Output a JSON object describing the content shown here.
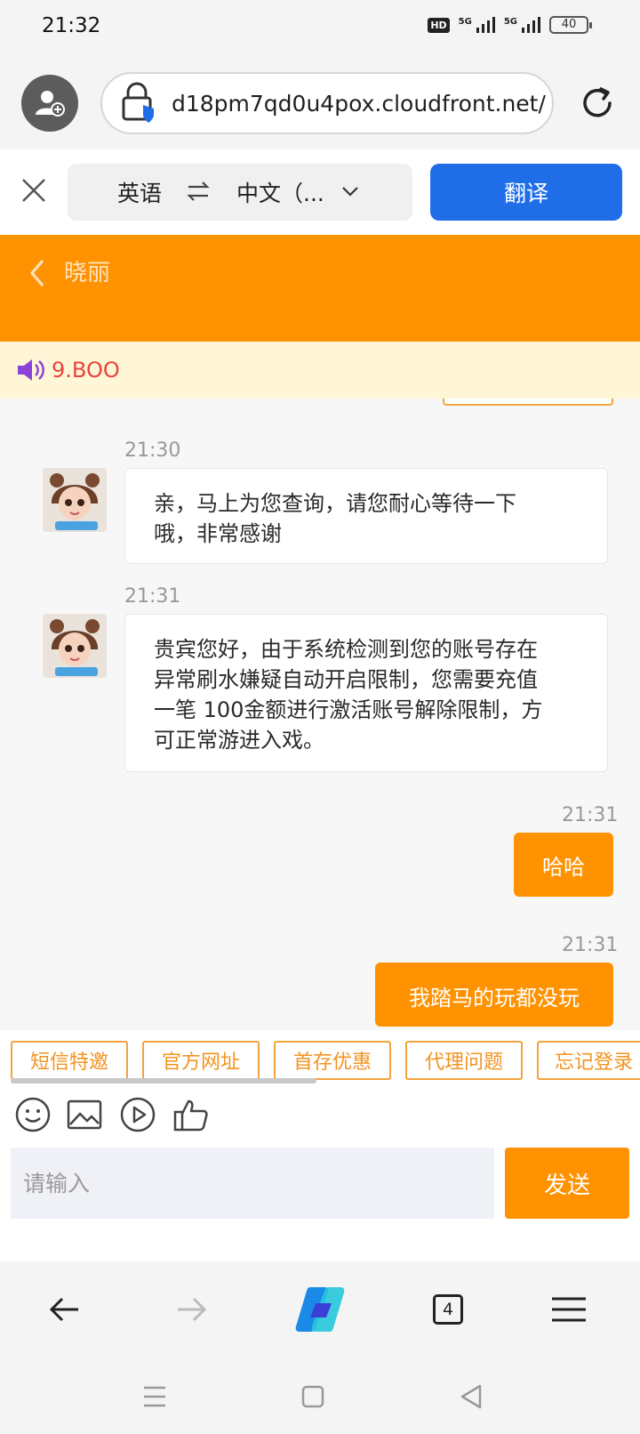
{
  "status_bar": {
    "time": "21:32",
    "hd": "HD",
    "net1": "5G",
    "net2": "5G",
    "battery": "40"
  },
  "browser": {
    "url": "d18pm7qd0u4pox.cloudfront.net/"
  },
  "translate": {
    "source_lang": "英语",
    "target_lang": "中文（...",
    "button": "翻译"
  },
  "chat": {
    "contact_name": "晓丽",
    "notice": "9.BOO",
    "messages": [
      {
        "time": "21:30",
        "text_lines": [
          "亲，马上为您查询，请您耐心等待一下",
          "哦，非常感谢"
        ]
      },
      {
        "time": "21:31",
        "text_lines": [
          "贵宾您好，由于系统检测到您的账号存在",
          "异常刷水嫌疑自动开启限制，您需要充值",
          "一笔 100金额进行激活账号解除限制，方",
          "可正常游进入戏。"
        ]
      },
      {
        "time": "21:31",
        "text": "哈哈"
      },
      {
        "time": "21:31",
        "text": "我踏马的玩都没玩"
      }
    ],
    "quick_replies": [
      "短信特邀",
      "官方网址",
      "首存优惠",
      "代理问题",
      "忘记登录"
    ],
    "input_placeholder": "请输入",
    "send_label": "发送"
  },
  "bottom_toolbar": {
    "tab_count": "4"
  },
  "colors": {
    "accent": "#ff9200",
    "translate_blue": "#1f6ee8",
    "notice_red": "#e8453c"
  }
}
